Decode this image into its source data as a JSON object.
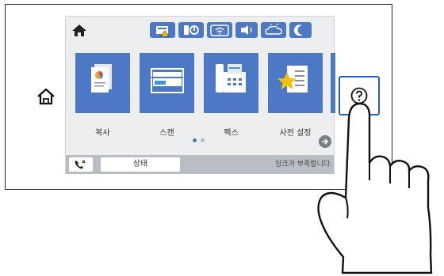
{
  "screen": {
    "apps": [
      {
        "label": "복사"
      },
      {
        "label": "스캔"
      },
      {
        "label": "팩스"
      },
      {
        "label": "사전 설정"
      }
    ],
    "status_button_label": "상태",
    "ink_message": "잉크가 부족합니다."
  },
  "colors": {
    "tile_blue": "#4d78c5",
    "highlight_blue": "#1f5fd8"
  },
  "icons": [
    "home-icon",
    "panel-home-icon",
    "fax-status-icon",
    "sd-card-icon",
    "wifi-icon",
    "wifi-direct-icon",
    "cloud-icon",
    "quiet-mode-icon",
    "copy-icon",
    "scan-icon",
    "fax-icon",
    "presets-icon",
    "next-arrow-icon",
    "call-icon",
    "help-icon",
    "hand-icon"
  ]
}
